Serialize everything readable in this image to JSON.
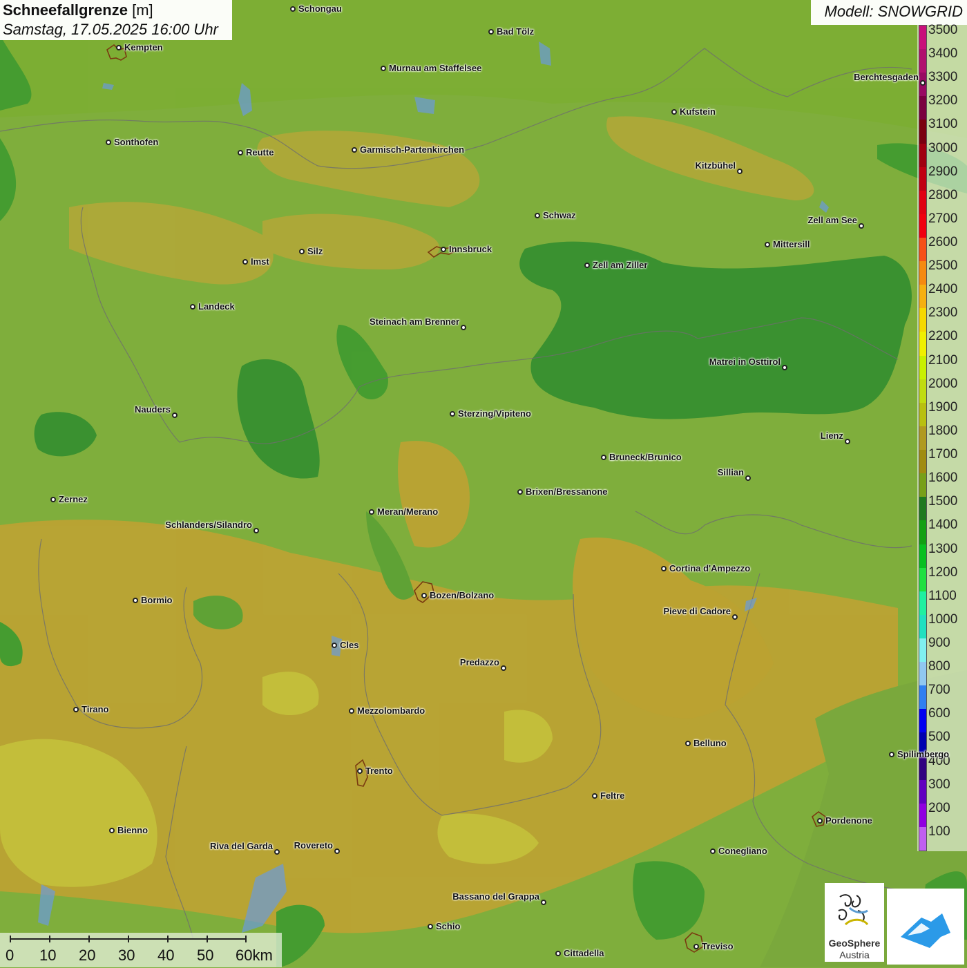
{
  "title": {
    "param_name": "Schneefallgrenze",
    "param_unit": "[m]",
    "datetime": "Samstag, 17.05.2025 16:00 Uhr"
  },
  "model": "Modell: SNOWGRID",
  "legend": {
    "labels": [
      "3500",
      "3400",
      "3300",
      "3200",
      "3100",
      "3000",
      "2900",
      "2800",
      "2700",
      "2600",
      "2500",
      "2400",
      "2300",
      "2200",
      "2100",
      "2000",
      "1900",
      "1800",
      "1700",
      "1600",
      "1500",
      "1400",
      "1300",
      "1200",
      "1100",
      "1000",
      "900",
      "800",
      "700",
      "600",
      "500",
      "400",
      "300",
      "200",
      "100"
    ],
    "colors": [
      "#c8107a",
      "#b0106e",
      "#980a62",
      "#7a0040",
      "#7a0010",
      "#a00010",
      "#c00012",
      "#e00012",
      "#f00010",
      "#f65018",
      "#f58a10",
      "#f5b010",
      "#f5d800",
      "#f0f000",
      "#c8f000",
      "#c0dc10",
      "#b8c010",
      "#b09a20",
      "#a08c10",
      "#78a018",
      "#1f7a1f",
      "#13a013",
      "#08c020",
      "#20e040",
      "#20f0a0",
      "#20e0c0",
      "#80f0f0",
      "#90c8f0",
      "#3080f0",
      "#0000f0",
      "#0000b0",
      "#300080",
      "#6000c0",
      "#9000e0",
      "#c060f0"
    ]
  },
  "cities": [
    {
      "name": "Schongau"
    },
    {
      "name": "Bad Tölz"
    },
    {
      "name": "Kempten"
    },
    {
      "name": "Murnau am Staffelsee"
    },
    {
      "name": "Kufstein"
    },
    {
      "name": "Berchtesgaden"
    },
    {
      "name": "Sonthofen"
    },
    {
      "name": "Reutte"
    },
    {
      "name": "Garmisch-Partenkirchen"
    },
    {
      "name": "Kitzbühel"
    },
    {
      "name": "Schwaz"
    },
    {
      "name": "Zell am See"
    },
    {
      "name": "Innsbruck"
    },
    {
      "name": "Mittersill"
    },
    {
      "name": "Imst"
    },
    {
      "name": "Silz"
    },
    {
      "name": "Zell am Ziller"
    },
    {
      "name": "Landeck"
    },
    {
      "name": "Steinach am Brenner"
    },
    {
      "name": "Matrei in Osttirol"
    },
    {
      "name": "Nauders"
    },
    {
      "name": "Sterzing/Vipiteno"
    },
    {
      "name": "Lienz"
    },
    {
      "name": "Bruneck/Brunico"
    },
    {
      "name": "Sillian"
    },
    {
      "name": "Zernez"
    },
    {
      "name": "Brixen/Bressanone"
    },
    {
      "name": "Meran/Merano"
    },
    {
      "name": "Schlanders/Silandro"
    },
    {
      "name": "Cortina d'Ampezzo"
    },
    {
      "name": "Bozen/Bolzano"
    },
    {
      "name": "Bormio"
    },
    {
      "name": "Pieve di Cadore"
    },
    {
      "name": "Cles"
    },
    {
      "name": "Predazzo"
    },
    {
      "name": "Tirano"
    },
    {
      "name": "Mezzolombardo"
    },
    {
      "name": "Belluno"
    },
    {
      "name": "Spilimbergo"
    },
    {
      "name": "Trento"
    },
    {
      "name": "Feltre"
    },
    {
      "name": "Pordenone"
    },
    {
      "name": "Bienno"
    },
    {
      "name": "Riva del Garda"
    },
    {
      "name": "Rovereto"
    },
    {
      "name": "Conegliano"
    },
    {
      "name": "Bassano del Grappa"
    },
    {
      "name": "Schio"
    },
    {
      "name": "Treviso"
    },
    {
      "name": "Cittadella"
    }
  ],
  "scale": {
    "labels": [
      "0",
      "10",
      "20",
      "30",
      "40",
      "50",
      "60km"
    ]
  },
  "logo": {
    "line1": "GeoSphere",
    "line2": "Austria"
  }
}
